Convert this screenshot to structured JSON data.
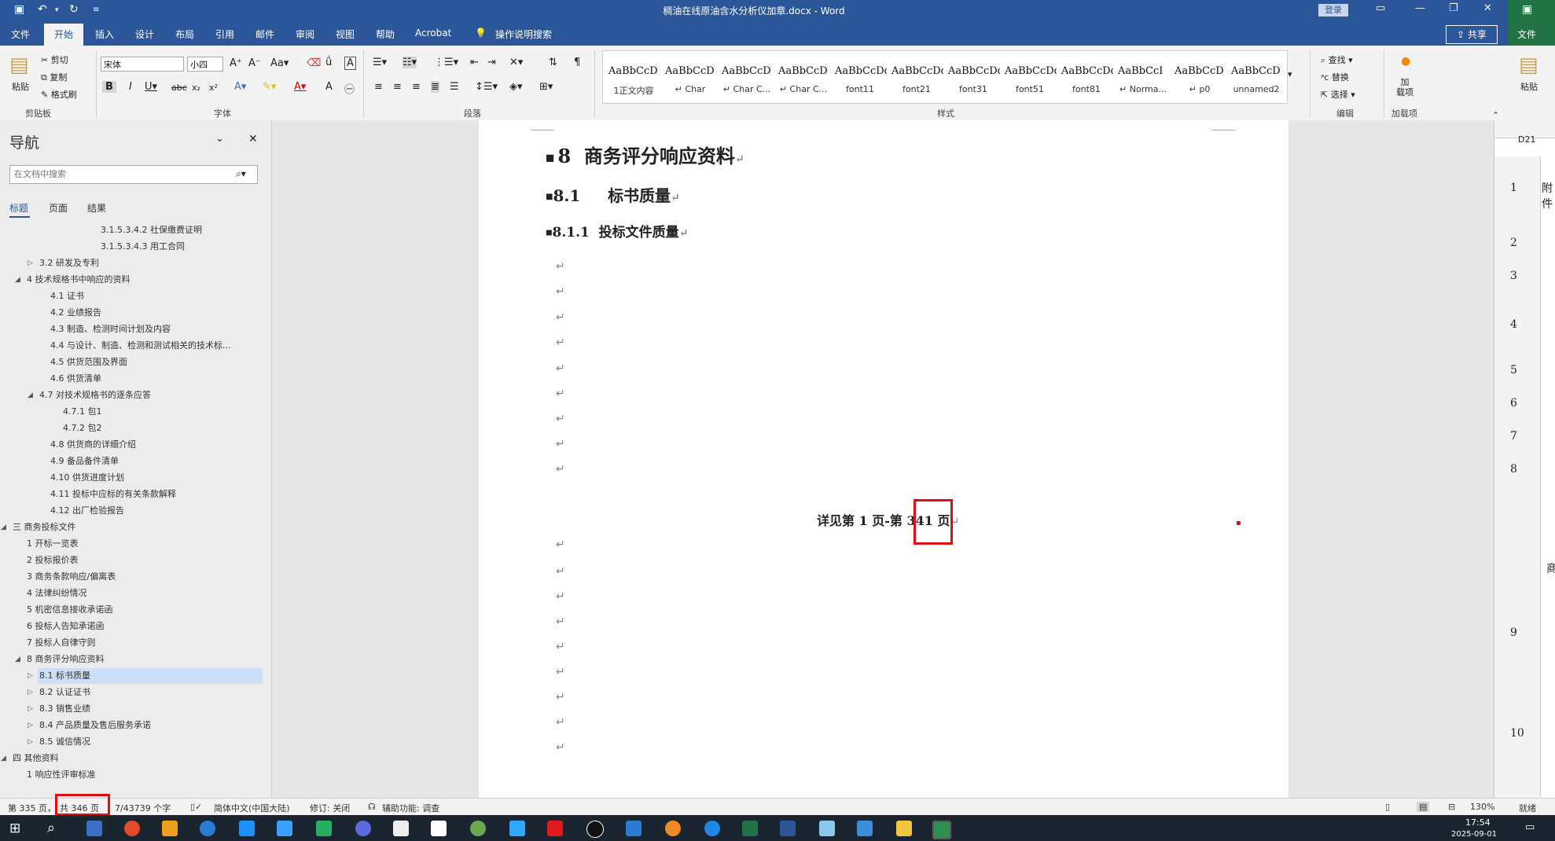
{
  "window": {
    "title": "稠油在线原油含水分析仪加章.docx - Word",
    "login_label": "登录",
    "share_label": "共享",
    "tell_me": "操作说明搜索"
  },
  "tabs": [
    "文件",
    "开始",
    "插入",
    "设计",
    "布局",
    "引用",
    "邮件",
    "审阅",
    "视图",
    "帮助",
    "Acrobat"
  ],
  "ribbon": {
    "clipboard": {
      "paste": "粘贴",
      "cut": "剪切",
      "copy": "复制",
      "format_painter": "格式刷",
      "label": "剪贴板"
    },
    "font": {
      "name": "宋体",
      "size": "小四",
      "label": "字体"
    },
    "paragraph": {
      "label": "段落"
    },
    "styles": {
      "label": "样式",
      "items": [
        {
          "preview": "AaBbCcD",
          "name": "1正文内容"
        },
        {
          "preview": "AaBbCcD",
          "name": "↵ Char"
        },
        {
          "preview": "AaBbCcD",
          "name": "↵ Char C..."
        },
        {
          "preview": "AaBbCcD",
          "name": "↵ Char C..."
        },
        {
          "preview": "AaBbCcDdE",
          "name": "font11"
        },
        {
          "preview": "AaBbCcDdE",
          "name": "font21"
        },
        {
          "preview": "AaBbCcDdEe",
          "name": "font31"
        },
        {
          "preview": "AaBbCcDdEe",
          "name": "font51"
        },
        {
          "preview": "AaBbCcDdEe",
          "name": "font81"
        },
        {
          "preview": "AaBbCcI",
          "name": "↵ Norma..."
        },
        {
          "preview": "AaBbCcD",
          "name": "↵ p0"
        },
        {
          "preview": "AaBbCcD",
          "name": "unnamed2"
        }
      ]
    },
    "editing": {
      "find": "查找",
      "replace": "替换",
      "select": "选择",
      "label": "编辑"
    },
    "addins": {
      "label_btn": "加\n载项",
      "label": "加载项"
    }
  },
  "nav": {
    "title": "导航",
    "search_placeholder": "在文档中搜索",
    "tabs": [
      "标题",
      "页面",
      "结果"
    ],
    "items": [
      {
        "text": "3.1.5.3.4.2 社保缴费证明",
        "level": 6,
        "arrow": ""
      },
      {
        "text": "3.1.5.3.4.3 用工合同",
        "level": 6,
        "arrow": ""
      },
      {
        "text": "3.2 研发及专利",
        "level": 2,
        "arrow": "▷"
      },
      {
        "text": "4 技术规格书中响应的资料",
        "level": 1,
        "arrow": "◢"
      },
      {
        "text": "4.1 证书",
        "level": 3,
        "arrow": ""
      },
      {
        "text": "4.2 业绩报告",
        "level": 3,
        "arrow": ""
      },
      {
        "text": "4.3 制造、检测时间计划及内容",
        "level": 3,
        "arrow": ""
      },
      {
        "text": "4.4 与设计、制造、检测和测试相关的技术标...",
        "level": 3,
        "arrow": ""
      },
      {
        "text": "4.5 供货范围及界面",
        "level": 3,
        "arrow": ""
      },
      {
        "text": "4.6 供货清单",
        "level": 3,
        "arrow": ""
      },
      {
        "text": "4.7 对技术规格书的逐条应答",
        "level": 2,
        "arrow": "◢"
      },
      {
        "text": "4.7.1 包1",
        "level": 4,
        "arrow": ""
      },
      {
        "text": "4.7.2 包2",
        "level": 4,
        "arrow": ""
      },
      {
        "text": "4.8 供货商的详细介绍",
        "level": 3,
        "arrow": ""
      },
      {
        "text": "4.9 备品备件清单",
        "level": 3,
        "arrow": ""
      },
      {
        "text": "4.10 供货进度计划",
        "level": 3,
        "arrow": ""
      },
      {
        "text": "4.11 投标中应标的有关条款解释",
        "level": 3,
        "arrow": ""
      },
      {
        "text": "4.12 出厂检验报告",
        "level": 3,
        "arrow": ""
      },
      {
        "text": "三 商务投标文件",
        "level": 0,
        "arrow": "◢"
      },
      {
        "text": "1 开标一览表",
        "level": 1,
        "arrow": ""
      },
      {
        "text": "2 投标报价表",
        "level": 1,
        "arrow": ""
      },
      {
        "text": "3 商务条款响应/偏离表",
        "level": 1,
        "arrow": ""
      },
      {
        "text": "4 法律纠纷情况",
        "level": 1,
        "arrow": ""
      },
      {
        "text": "5 机密信息接收承诺函",
        "level": 1,
        "arrow": ""
      },
      {
        "text": "6 投标人告知承诺函",
        "level": 1,
        "arrow": ""
      },
      {
        "text": "7 投标人自律守则",
        "level": 1,
        "arrow": ""
      },
      {
        "text": "8 商务评分响应资料",
        "level": 1,
        "arrow": "◢"
      },
      {
        "text": "8.1 标书质量",
        "level": 2,
        "arrow": "▷",
        "selected": true
      },
      {
        "text": "8.2 认证证书",
        "level": 2,
        "arrow": "▷"
      },
      {
        "text": "8.3 销售业绩",
        "level": 2,
        "arrow": "▷"
      },
      {
        "text": "8.4 产品质量及售后服务承诺",
        "level": 2,
        "arrow": "▷"
      },
      {
        "text": "8.5 诚信情况",
        "level": 2,
        "arrow": "▷"
      },
      {
        "text": "四 其他资料",
        "level": 0,
        "arrow": "◢"
      },
      {
        "text": "1 响应性评审标准",
        "level": 1,
        "arrow": ""
      }
    ]
  },
  "document": {
    "heading1": "8  商务评分响应资料",
    "heading2": "8.1     标书质量",
    "heading3": "8.1.1  投标文件质量",
    "center_text_before": "详见第 1 页-第 ",
    "center_text_highlight": "341",
    "center_text_after": " 页",
    "para_mark": "↵"
  },
  "right_window": {
    "name_box": "D21",
    "rows": [
      "1",
      "2",
      "3",
      "4",
      "5",
      "6",
      "7",
      "8",
      "9",
      "10"
    ],
    "cell_text": "附件",
    "tab_file": "文件",
    "paste": "粘贴",
    "side_chars": "商"
  },
  "status": {
    "page": "第 335 页，",
    "total_pages": "共 346 页",
    "words": "7/43739 个字",
    "language": "简体中文(中国大陆)",
    "track_changes": "修订: 关闭",
    "accessibility": "辅助功能: 调查",
    "zoom": "130%",
    "ready": "就绪"
  },
  "taskbar": {
    "time": "17:54",
    "date": "2025-09-01"
  },
  "colors": {
    "word_blue": "#2b579a",
    "excel_green": "#217346",
    "highlight_red": "#e01010",
    "nav_selected": "#cddff7"
  }
}
